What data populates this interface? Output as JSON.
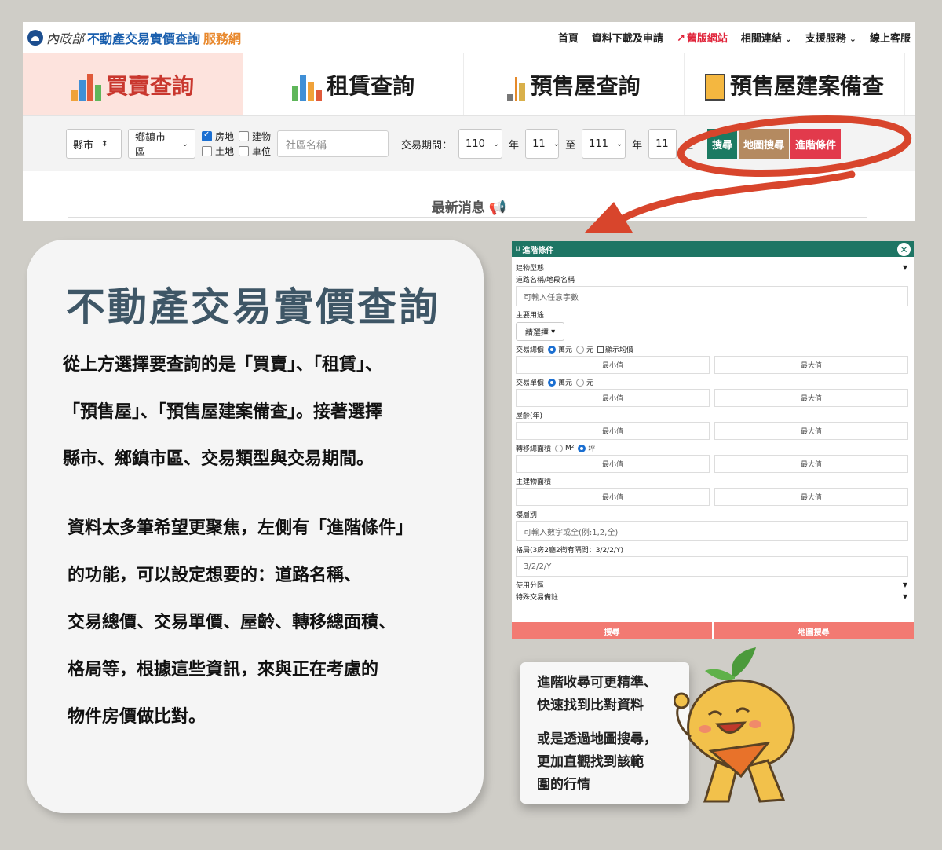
{
  "navbar": {
    "logo_ministry": "內政部",
    "logo_main": "不動產交易實價查詢",
    "logo_accent": "服務網",
    "links": [
      "首頁",
      "資料下載及申請",
      "舊版網站",
      "相關連結",
      "支援服務",
      "線上客服"
    ]
  },
  "tabs": [
    "買賣查詢",
    "租賃查詢",
    "預售屋查詢",
    "預售屋建案備查"
  ],
  "filter": {
    "county": "縣市",
    "district": "鄉鎮市區",
    "checks": [
      "房地",
      "建物",
      "土地",
      "車位"
    ],
    "community_placeholder": "社區名稱",
    "period_label": "交易期間：",
    "from_year": "110",
    "from_month": "11",
    "year_unit": "年",
    "to": "至",
    "to_year": "111",
    "to_month": "11",
    "end": "止",
    "btn_search": "搜尋",
    "btn_map": "地圖搜尋",
    "btn_adv": "進階條件"
  },
  "news_title": "最新消息",
  "card": {
    "title": "不動產交易實價查詢",
    "p1_lines": [
      "從上方選擇要查詢的是「買賣」、「租賃」、",
      "「預售屋」、「預售屋建案備查」。接著選擇",
      "縣市、鄉鎮市區、交易類型與交易期間。"
    ],
    "p2_lines": [
      "資料太多筆希望更聚焦，左側有「進階條件」",
      "的功能，可以設定想要的：道路名稱、",
      "交易總價、交易單價、屋齡、轉移總面積、",
      "格局等，根據這些資訊，來與正在考慮的",
      "物件房價做比對。"
    ]
  },
  "adv": {
    "header": "進階條件",
    "building_type": "建物型態",
    "road_label": "道路名稱/地段名稱",
    "road_placeholder": "可輸入任意字數",
    "main_use": "主要用途",
    "main_use_select": "請選擇",
    "total_price": "交易總價",
    "unit_wan": "萬元",
    "unit_yuan": "元",
    "show_avg": "顯示均價",
    "min": "最小值",
    "max": "最大值",
    "unit_price": "交易單價",
    "age": "屋齡(年)",
    "area": "轉移總面積",
    "m2": "M²",
    "ping": "坪",
    "main_area": "主建物面積",
    "floor": "樓層別",
    "floor_placeholder": "可輸入數字或全(例:1,2,全)",
    "layout": "格局(3房2廳2衛有隔間：3/2/2/Y)",
    "layout_value": "3/2/2/Y",
    "zoning": "使用分區",
    "special": "特殊交易備註",
    "foot_search": "搜尋",
    "foot_map": "地圖搜尋"
  },
  "bubble": {
    "lines_a": [
      "進階收尋可更精準、",
      "快速找到比對資料"
    ],
    "lines_b": [
      "或是透過地圖搜尋，",
      "更加直觀找到該範",
      "圍的行情"
    ]
  },
  "colors": {
    "highlight_red": "#d8452c",
    "panel_green": "#1e7564",
    "title_slate": "#3e5666"
  }
}
